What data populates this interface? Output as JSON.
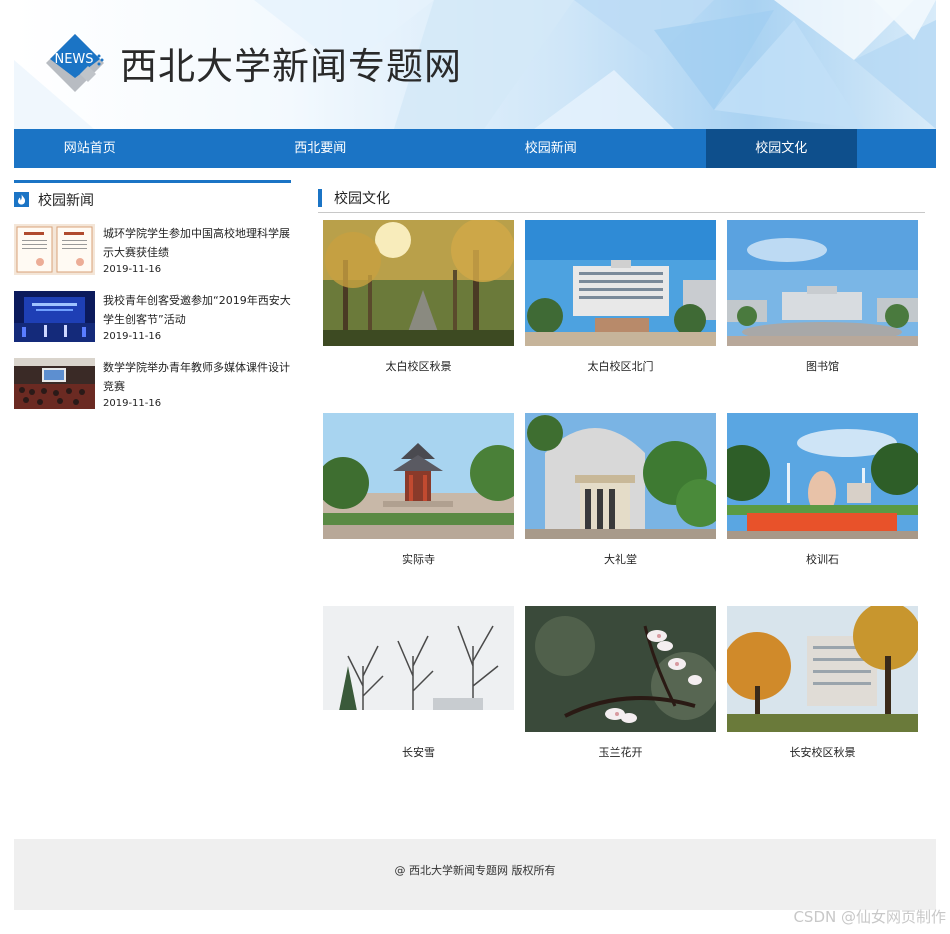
{
  "header": {
    "logo_text": "NEWS",
    "site_title": "西北大学新闻专题网"
  },
  "nav": {
    "items": [
      "网站首页",
      "西北要闻",
      "校园新闻",
      "校园文化"
    ],
    "active_index": 3
  },
  "sidebar": {
    "title": "校园新闻",
    "items": [
      {
        "title": "城环学院学生参加中国高校地理科学展示大赛获佳绩",
        "date": "2019-11-16"
      },
      {
        "title": "我校青年创客受邀参加“2019年西安大学生创客节”活动",
        "date": "2019-11-16"
      },
      {
        "title": "数学学院举办青年教师多媒体课件设计竞赛",
        "date": "2019-11-16"
      }
    ]
  },
  "main": {
    "title": "校园文化",
    "photos": [
      {
        "caption": "太白校区秋景"
      },
      {
        "caption": "太白校区北门"
      },
      {
        "caption": "图书馆"
      },
      {
        "caption": "实际寺"
      },
      {
        "caption": "大礼堂"
      },
      {
        "caption": "校训石"
      },
      {
        "caption": "长安雪"
      },
      {
        "caption": "玉兰花开"
      },
      {
        "caption": "长安校区秋景"
      }
    ]
  },
  "footer": {
    "text": "@ 西北大学新闻专题网 版权所有"
  },
  "watermark": "CSDN @仙女网页制作",
  "colors": {
    "brand_blue": "#1b74c5",
    "nav_active": "#0e4f8c",
    "footer_bg": "#efefef"
  }
}
